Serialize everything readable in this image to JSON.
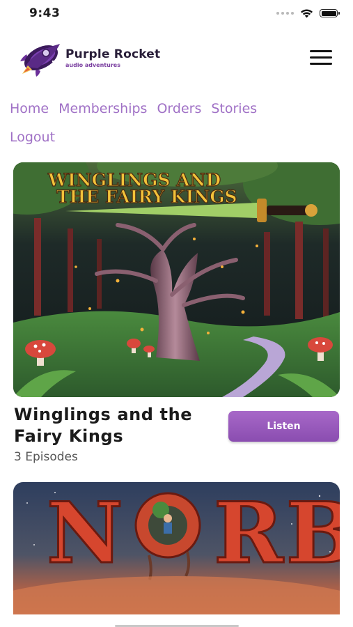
{
  "status_bar": {
    "time": "9:43"
  },
  "header": {
    "logo_name": "Purple Rocket",
    "logo_tagline": "audio adventures",
    "menu_icon": "hamburger-menu-icon"
  },
  "nav": {
    "links": [
      "Home",
      "Memberships",
      "Orders",
      "Stories",
      "Logout"
    ]
  },
  "stories": [
    {
      "cover_title": "WINGLINGS AND THE FAIRY KINGS",
      "title": "Winglings and the Fairy Kings",
      "episodes": "3 Episodes",
      "button_label": "Listen"
    },
    {
      "cover_title": "NORB"
    }
  ],
  "colors": {
    "accent": "#a071c6",
    "button": "#9b5cc0",
    "text": "#1b1b1b"
  }
}
